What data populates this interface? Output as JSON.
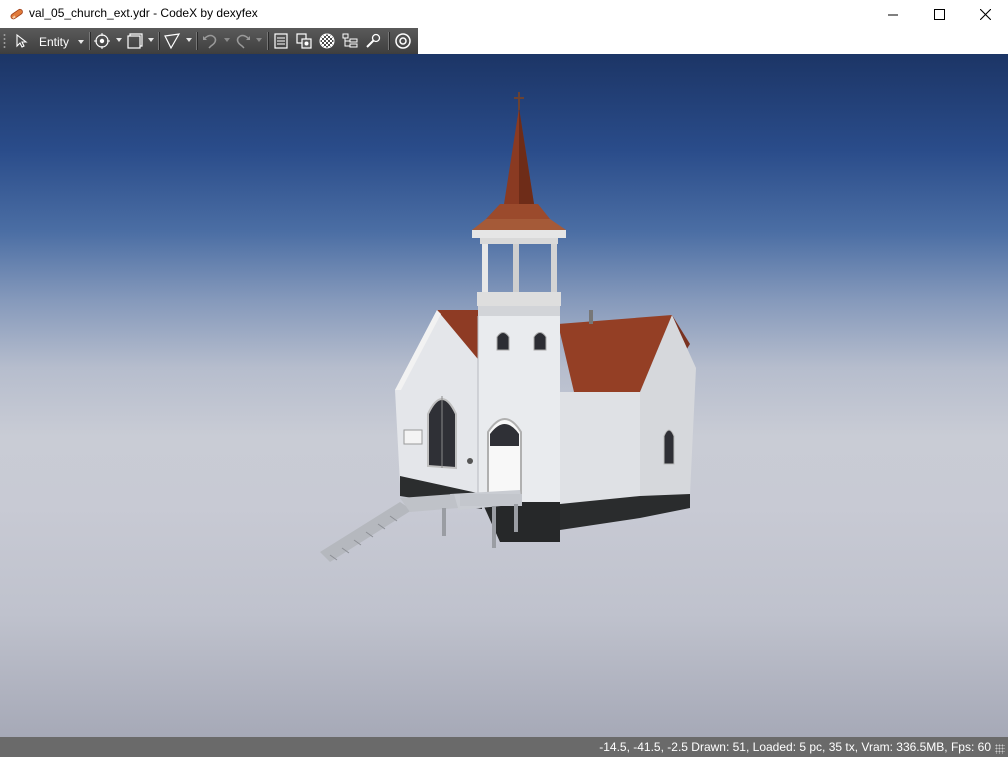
{
  "window": {
    "title": "val_05_church_ext.ydr - CodeX by dexyfex",
    "icon": "feather-pen-icon",
    "controls": [
      "minimize-icon",
      "maximize-icon",
      "close-icon"
    ]
  },
  "toolbar": {
    "mode_label": "Entity",
    "buttons": [
      {
        "name": "select-pointer-icon"
      },
      {
        "name": "mode-dropdown"
      },
      {
        "name": "move-gizmo-icon"
      },
      {
        "name": "view-mode-icon"
      },
      {
        "name": "snap-icon"
      },
      {
        "name": "undo-icon",
        "enabled": false
      },
      {
        "name": "redo-icon",
        "enabled": false
      },
      {
        "name": "file-icon"
      },
      {
        "name": "copy-icon"
      },
      {
        "name": "checkered-texture-icon"
      },
      {
        "name": "hierarchy-icon"
      },
      {
        "name": "wrench-icon"
      },
      {
        "name": "settings-gear-icon"
      }
    ]
  },
  "viewport": {
    "model": "church building with steeple and wooden stairs"
  },
  "status": {
    "text": "-14.5, -41.5, -2.5   Drawn: 51, Loaded: 5 pc, 35 tx, Vram: 336.5MB, Fps: 60"
  }
}
